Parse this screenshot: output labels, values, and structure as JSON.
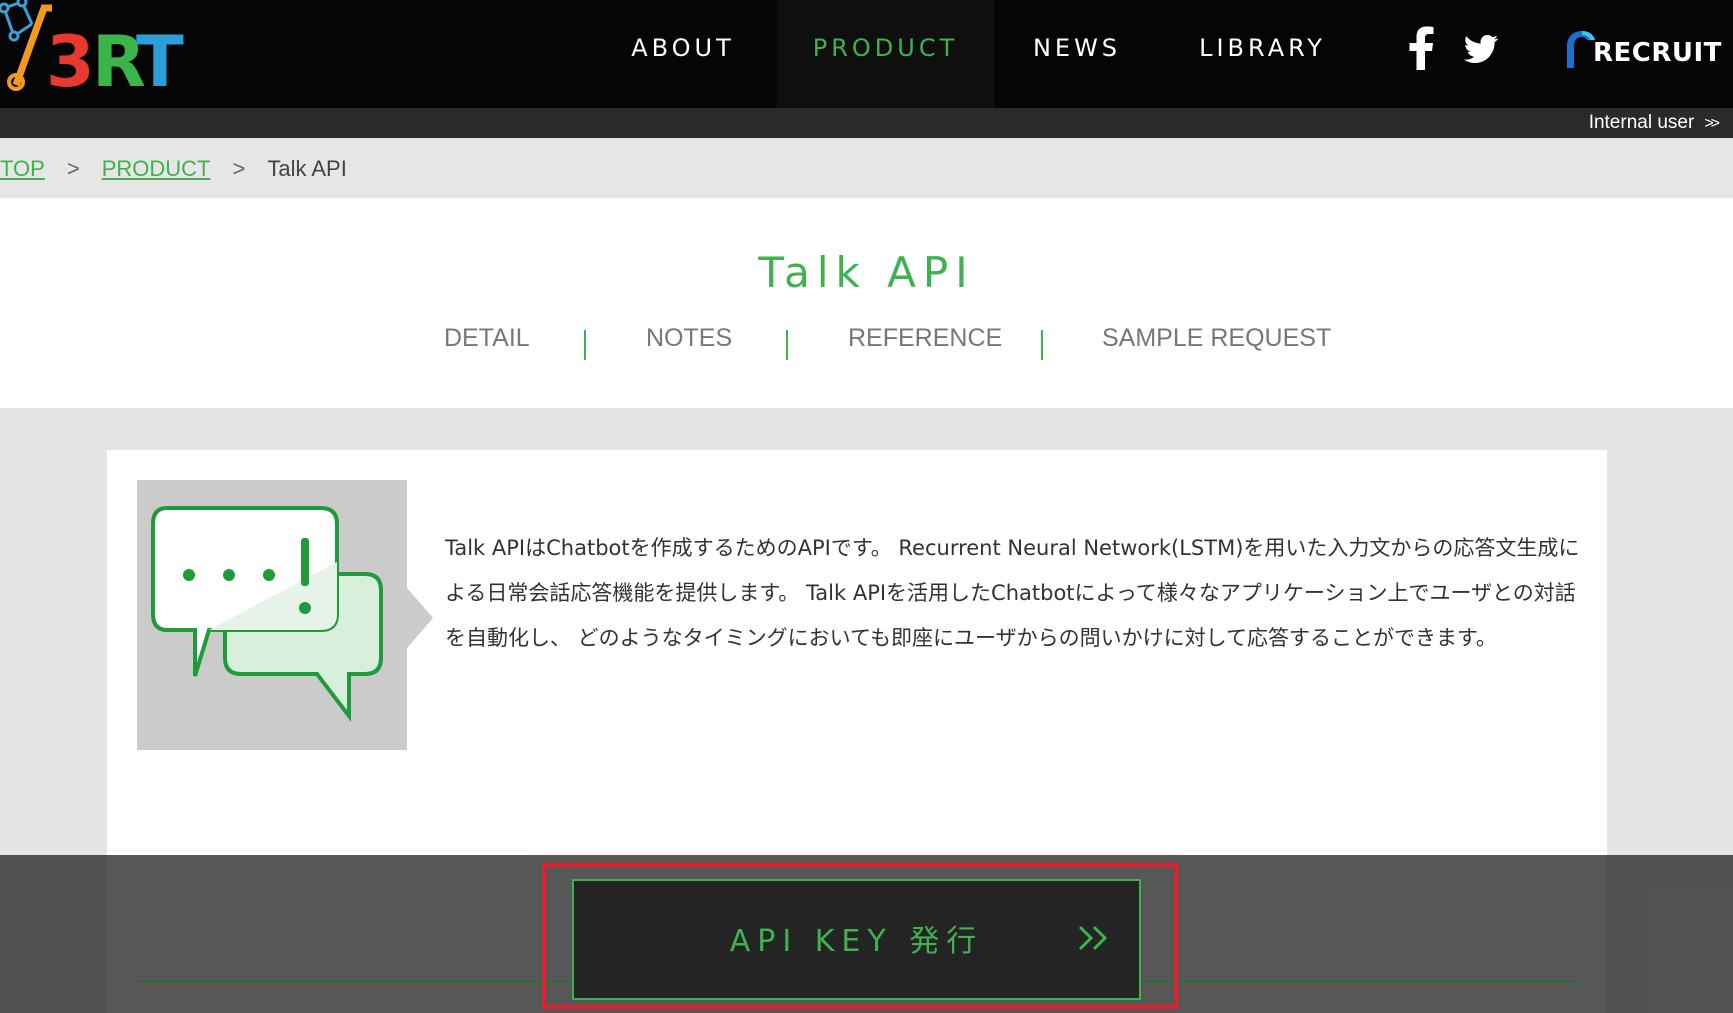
{
  "header": {
    "logo_alt": "A3RT",
    "nav": [
      {
        "label": "ABOUT",
        "active": false
      },
      {
        "label": "PRODUCT",
        "active": true
      },
      {
        "label": "NEWS",
        "active": false
      },
      {
        "label": "LIBRARY",
        "active": false
      }
    ],
    "social": [
      "facebook-icon",
      "twitter-icon"
    ],
    "brand": "RECRUIT"
  },
  "subbar": {
    "internal_user": "Internal user",
    "chevron": ">>"
  },
  "breadcrumb": {
    "items": [
      "TOP",
      "PRODUCT",
      "Talk API"
    ],
    "separator": ">"
  },
  "page": {
    "title": "Talk API",
    "tabs": [
      "DETAIL",
      "NOTES",
      "REFERENCE",
      "SAMPLE REQUEST"
    ]
  },
  "content": {
    "description": "Talk APIはChatbotを作成するためのAPIです。 Recurrent Neural Network(LSTM)を用いた入力文からの応答文生成による日常会話応答機能を提供します。 Talk APIを活用したChatbotによって様々なアプリケーション上でユーザとの対話を自動化し、 どのようなタイミングにおいても即座にユーザからの問いかけに対して応答することができます。",
    "illustration": "chat-bubbles-icon"
  },
  "cta": {
    "label": "API KEY 発行",
    "chevron": ">>"
  },
  "colors": {
    "accent": "#3fb24f",
    "header_bg": "#050505",
    "highlight": "#e0202b"
  }
}
